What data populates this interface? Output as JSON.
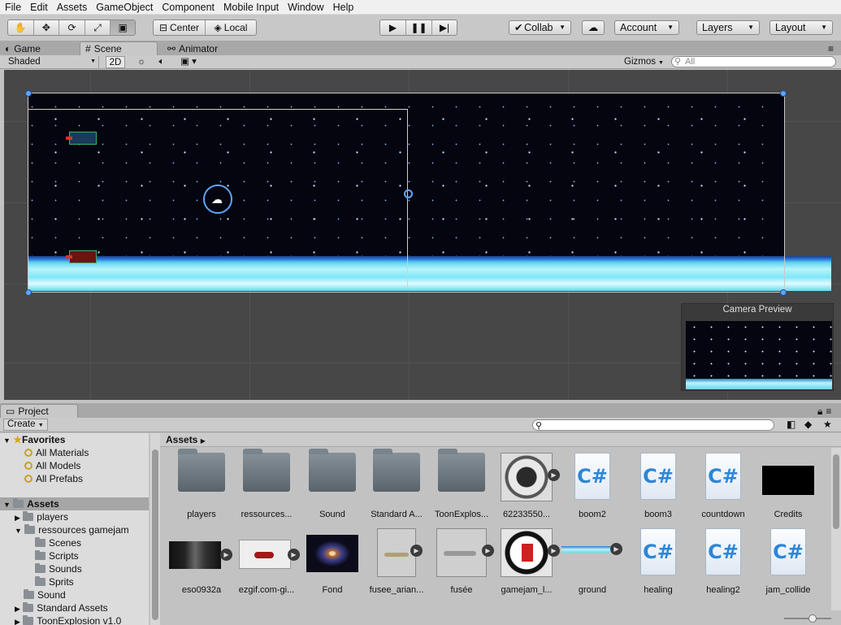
{
  "menu": [
    "File",
    "Edit",
    "Assets",
    "GameObject",
    "Component",
    "Mobile Input",
    "Window",
    "Help"
  ],
  "toolbar": {
    "transform_tools": [
      "hand-icon",
      "move-icon",
      "rotate-icon",
      "scale-icon",
      "rect-icon"
    ],
    "pivot_label": "Center",
    "space_label": "Local",
    "collab_label": "Collab",
    "account_label": "Account",
    "layers_label": "Layers",
    "layout_label": "Layout"
  },
  "tabs": {
    "game": "Game",
    "scene": "Scene",
    "animator": "Animator"
  },
  "scenebar": {
    "shading": "Shaded",
    "mode_2d": "2D",
    "gizmos": "Gizmos",
    "search_placeholder": "All"
  },
  "camera_preview_title": "Camera Preview",
  "project": {
    "tab": "Project",
    "create_label": "Create",
    "breadcrumb": "Assets",
    "tree": [
      {
        "label": "Favorites",
        "bold": true
      },
      {
        "label": "All Materials"
      },
      {
        "label": "All Models"
      },
      {
        "label": "All Prefabs"
      },
      {
        "label": "Assets",
        "bold": true
      },
      {
        "label": "players"
      },
      {
        "label": "ressources gamejam"
      },
      {
        "label": "Scenes"
      },
      {
        "label": "Scripts"
      },
      {
        "label": "Sounds"
      },
      {
        "label": "Sprits"
      },
      {
        "label": "Sound"
      },
      {
        "label": "Standard Assets"
      },
      {
        "label": "ToonExplosion v1.0"
      }
    ],
    "assets": [
      {
        "label": "players",
        "kind": "folder"
      },
      {
        "label": "ressources...",
        "kind": "folder"
      },
      {
        "label": "Sound",
        "kind": "folder"
      },
      {
        "label": "Standard A...",
        "kind": "folder"
      },
      {
        "label": "ToonExplos...",
        "kind": "folder"
      },
      {
        "label": "62233550...",
        "kind": "image"
      },
      {
        "label": "boom2",
        "kind": "script"
      },
      {
        "label": "boom3",
        "kind": "script"
      },
      {
        "label": "countdown",
        "kind": "script"
      },
      {
        "label": "Credits",
        "kind": "black"
      },
      {
        "label": "eso0932a",
        "kind": "image"
      },
      {
        "label": "ezgif.com-gi...",
        "kind": "image"
      },
      {
        "label": "Fond",
        "kind": "image"
      },
      {
        "label": "fusee_arian...",
        "kind": "image"
      },
      {
        "label": "fusée",
        "kind": "image"
      },
      {
        "label": "gamejam_l...",
        "kind": "image"
      },
      {
        "label": "ground",
        "kind": "image"
      },
      {
        "label": "healing",
        "kind": "script"
      },
      {
        "label": "healing2",
        "kind": "script"
      },
      {
        "label": "jam_collide",
        "kind": "script"
      }
    ],
    "script_glyph": "C#"
  }
}
